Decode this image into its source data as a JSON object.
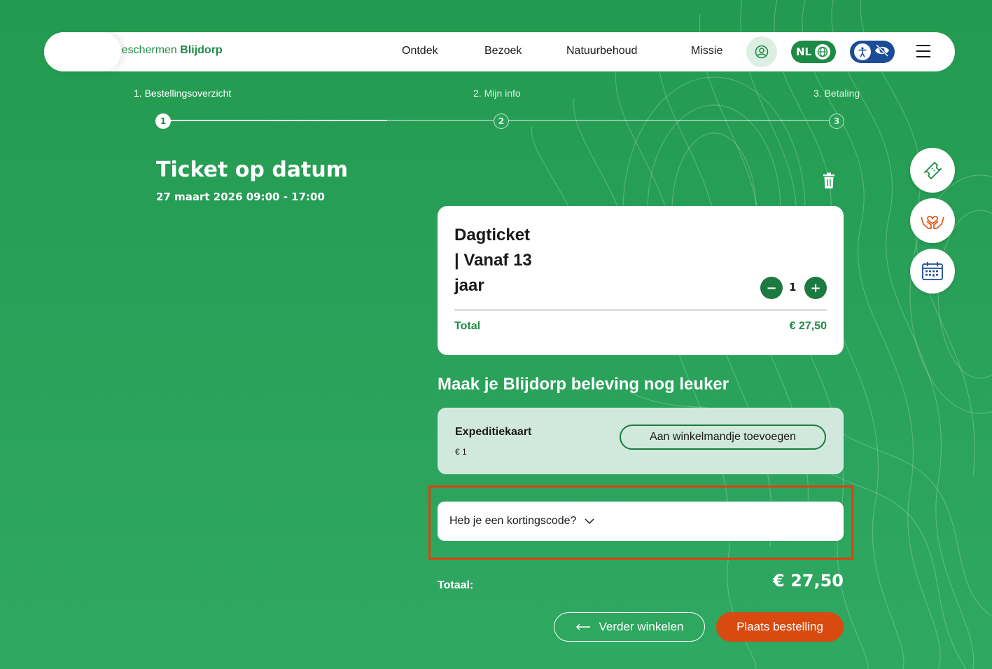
{
  "header": {
    "brand_regular": "Beschermen ",
    "brand_bold": "Blijdorp",
    "nav": [
      "Ontdek",
      "Bezoek",
      "Natuurbehoud",
      "Missie"
    ],
    "language": "NL"
  },
  "stepper": {
    "steps": [
      {
        "label": "1. Bestellingsoverzicht",
        "number": "1"
      },
      {
        "label": "2. Mijn info",
        "number": "2"
      },
      {
        "label": "3. Betaling",
        "number": "3"
      }
    ]
  },
  "ticket": {
    "title": "Ticket op datum",
    "date": "27 maart 2026 09:00 - 17:00"
  },
  "card": {
    "name_line1": "Dagticket",
    "name_line2": "| Vanaf 13",
    "name_line3": "jaar",
    "minus": "−",
    "quantity": "1",
    "plus": "+",
    "total_label": "Total",
    "total_value": "€ 27,50"
  },
  "upsell": {
    "heading": "Maak je Blijdorp beleving nog leuker",
    "name": "Expeditiekaart",
    "price": "€ 1",
    "button": "Aan winkelmandje toevoegen"
  },
  "discount": {
    "label": "Heb je een kortingscode?"
  },
  "summary": {
    "label": "Totaal:",
    "value": "€ 27,50"
  },
  "actions": {
    "back": "Verder winkelen",
    "order": "Plaats bestelling"
  },
  "colors": {
    "brand_green": "#1d8a45",
    "accent_orange": "#d94a10",
    "access_blue": "#1b4d96"
  }
}
